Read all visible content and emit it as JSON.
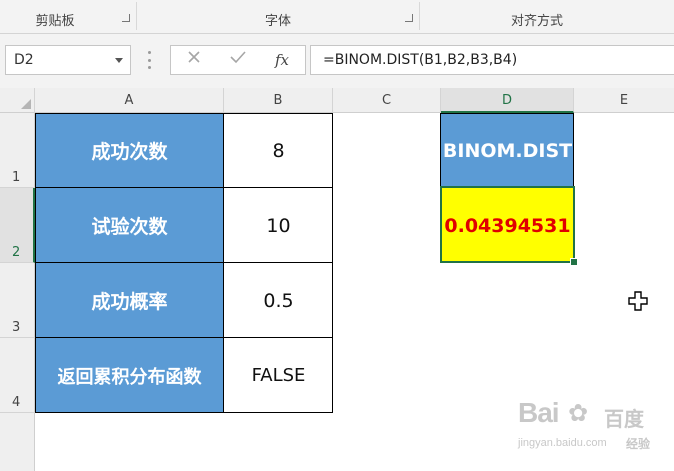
{
  "ribbon": {
    "groups": [
      {
        "label": "剪贴板"
      },
      {
        "label": "字体"
      },
      {
        "label": "对齐方式"
      }
    ]
  },
  "formula_bar": {
    "name_box": "D2",
    "cancel_icon": "close-icon",
    "enter_icon": "check-icon",
    "fx_label": "fx",
    "formula": "=BINOM.DIST(B1,B2,B3,B4)"
  },
  "columns": [
    "A",
    "B",
    "C",
    "D",
    "E"
  ],
  "rows": [
    "1",
    "2",
    "3",
    "4"
  ],
  "cells": {
    "A1": "成功次数",
    "B1": "8",
    "A2": "试验次数",
    "B2": "10",
    "A3": "成功概率",
    "B3": "0.5",
    "A4": "返回累积分布函数",
    "B4": "FALSE",
    "D1": "BINOM.DIST",
    "D2": "0.04394531"
  },
  "colors": {
    "label_fill": "#5b9bd5",
    "result_fill": "#ffff00",
    "result_text": "#e00000",
    "selection": "#217346"
  },
  "watermark": {
    "logo": "Bai",
    "logo_suffix": "百度",
    "brand": "经验",
    "url": "jingyan.baidu.com"
  }
}
